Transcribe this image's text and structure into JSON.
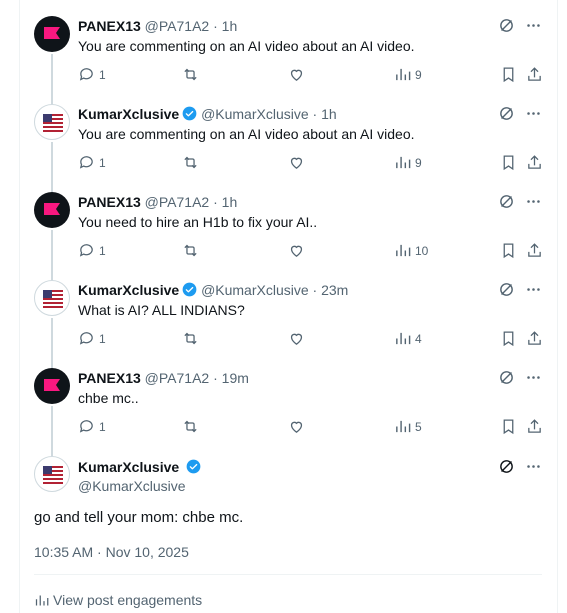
{
  "replies": [
    {
      "avatar": "pink-flag-avatar",
      "name": "PANEX13",
      "verified": false,
      "handle": "@PA71A2",
      "time": "1h",
      "text": "You are commenting on an AI video about an AI video.",
      "replies": "1",
      "reposts": "",
      "likes": "",
      "views": "9"
    },
    {
      "avatar": "kumar-flag-avatar",
      "name": "KumarXclusive",
      "verified": true,
      "handle": "@KumarXclusive",
      "time": "1h",
      "text": "You are commenting on an AI video about an AI video.",
      "replies": "1",
      "reposts": "",
      "likes": "",
      "views": "9"
    },
    {
      "avatar": "pink-flag-avatar",
      "name": "PANEX13",
      "verified": false,
      "handle": "@PA71A2",
      "time": "1h",
      "text": "You need to hire an H1b to fix your AI..",
      "replies": "1",
      "reposts": "",
      "likes": "",
      "views": "10"
    },
    {
      "avatar": "kumar-flag-avatar",
      "name": "KumarXclusive",
      "verified": true,
      "handle": "@KumarXclusive",
      "time": "23m",
      "text": "What is AI? ALL INDIANS?",
      "replies": "1",
      "reposts": "",
      "likes": "",
      "views": "4"
    },
    {
      "avatar": "pink-flag-avatar",
      "name": "PANEX13",
      "verified": false,
      "handle": "@PA71A2",
      "time": "19m",
      "text": "chbe mc..",
      "replies": "1",
      "reposts": "",
      "likes": "",
      "views": "5"
    }
  ],
  "main_post": {
    "name": "KumarXclusive",
    "handle": "@KumarXclusive",
    "text": "go and tell your mom: chbe mc.",
    "timestamp": "10:35 AM · Nov 10, 2025",
    "engagements_label": "View post engagements"
  },
  "colors": {
    "accent": "#1d9bf0",
    "muted": "#536471",
    "pink": "#f91880"
  },
  "icons": [
    "grok-icon",
    "more-icon",
    "reply-icon",
    "repost-icon",
    "like-icon",
    "views-icon",
    "bookmark-icon",
    "share-icon",
    "verified-badge-icon"
  ]
}
